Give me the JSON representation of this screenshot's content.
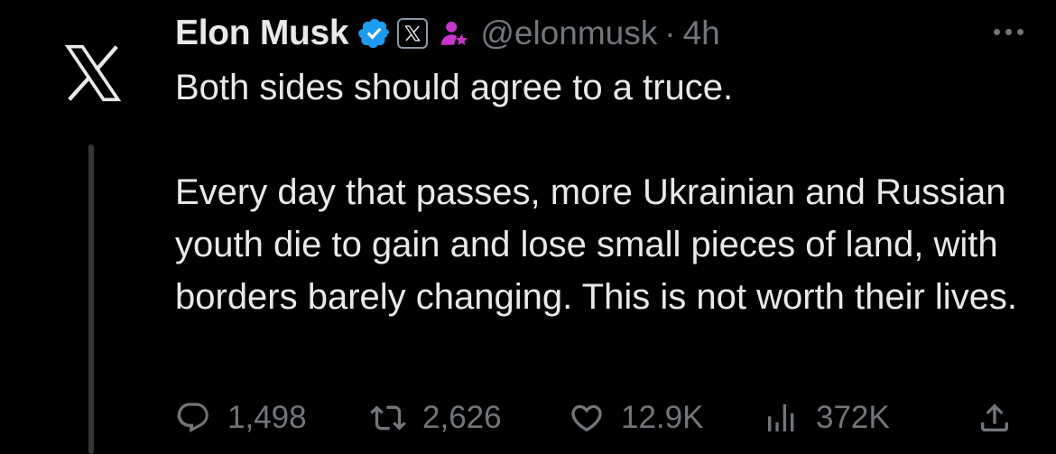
{
  "tweet": {
    "author_name": "Elon Musk",
    "handle": "@elonmusk",
    "separator": "·",
    "time": "4h",
    "text_paragraph_1": "Both sides should agree to a truce.",
    "text_paragraph_2": "Every day that passes, more Ukrainian and Russian youth die to gain and lose small pieces of land, with borders barely changing. This is not worth their lives.",
    "avatar_icon": "x-logo-icon",
    "badges": [
      "verified-badge-icon",
      "x-affiliation-icon",
      "creator-icon"
    ]
  },
  "metrics": {
    "replies": "1,498",
    "reposts": "2,626",
    "likes": "12.9K",
    "views": "372K"
  },
  "colors": {
    "background": "#000000",
    "primary_text": "#e7e9ea",
    "secondary_text": "#71767b",
    "verified_blue": "#1d9bf0",
    "creator_purple": "#c936cc",
    "thread_line": "#333639"
  }
}
